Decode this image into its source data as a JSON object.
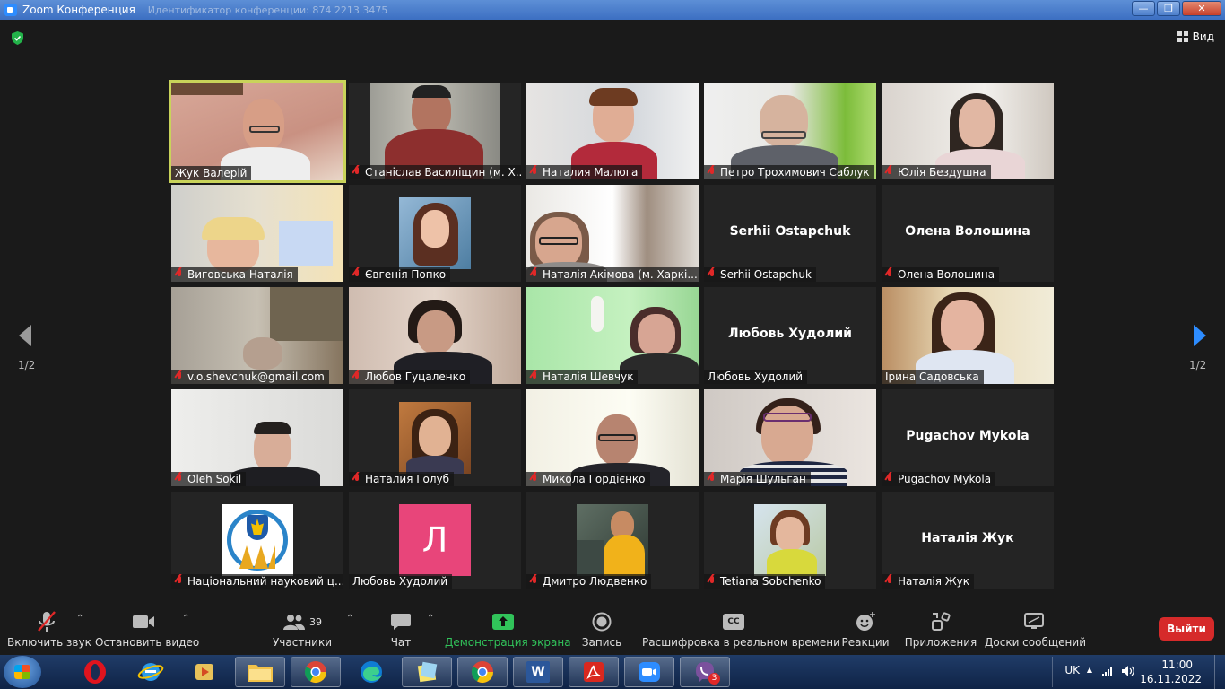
{
  "window": {
    "title": "Zoom Конференция",
    "faded_title": "Идентификатор конференции: 874 2213 3475",
    "minimize": "—",
    "maximize": "❐",
    "close": "✕"
  },
  "topbar": {
    "view_label": "Вид"
  },
  "gallery": {
    "page_left": "1/2",
    "page_right": "1/2",
    "tiles": [
      {
        "name": "Жук Валерій",
        "muted": false,
        "active": true
      },
      {
        "name": "Станіслав Василіщин (м. Х...",
        "muted": true
      },
      {
        "name": "Наталия Малюга",
        "muted": true
      },
      {
        "name": "Петро Трохимович Саблук",
        "muted": true
      },
      {
        "name": "Юлія Бездушна",
        "muted": true
      },
      {
        "name": "Виговська Наталія",
        "muted": true
      },
      {
        "name": "Євгенія Попко",
        "muted": true
      },
      {
        "name": "Наталія Акімова (м. Харкі...",
        "muted": true
      },
      {
        "name": "Serhii Ostapchuk",
        "muted": true,
        "big": "Serhii Ostapchuk"
      },
      {
        "name": "Олена Волошина",
        "muted": true,
        "big": "Олена Волошина"
      },
      {
        "name": "v.o.shevchuk@gmail.com",
        "muted": true
      },
      {
        "name": "Любов Гуцаленко",
        "muted": true
      },
      {
        "name": "Наталія Шевчук",
        "muted": true
      },
      {
        "name": "Любовь Худолий",
        "muted": false,
        "big": "Любовь Худолий"
      },
      {
        "name": "Ірина Садовська",
        "muted": false
      },
      {
        "name": "Oleh Sokil",
        "muted": true
      },
      {
        "name": "Наталия Голуб",
        "muted": true
      },
      {
        "name": "Микола Гордієнко",
        "muted": true
      },
      {
        "name": "Марія Шульган",
        "muted": true
      },
      {
        "name": "Pugachov Mykola",
        "muted": true,
        "big": "Pugachov Mykola"
      },
      {
        "name": "Національний науковий ц...",
        "muted": true
      },
      {
        "name": "Любовь Худолий",
        "muted": false,
        "letter": "Л"
      },
      {
        "name": "Дмитро Людвенко",
        "muted": true
      },
      {
        "name": "Tetiana Sobchenko",
        "muted": true
      },
      {
        "name": "Наталія Жук",
        "muted": true,
        "big": "Наталія Жук"
      }
    ]
  },
  "toolbar": {
    "audio": "Включить звук",
    "video": "Остановить видео",
    "participants": "Участники",
    "participants_count": "39",
    "chat": "Чат",
    "share": "Демонстрация экрана",
    "record": "Запись",
    "captions": "Расшифровка в реальном времени",
    "captions_badge": "CC",
    "reactions": "Реакции",
    "apps": "Приложения",
    "whiteboards": "Доски сообщений",
    "leave": "Выйти"
  },
  "taskbar": {
    "word_label": "W",
    "viber_badge": "3",
    "lang": "UK",
    "time": "11:00",
    "date": "16.11.2022"
  },
  "colors": {
    "active_speaker": "#c9d35a",
    "share_green": "#31c35a",
    "leave_red": "#d62a2a",
    "muted_red": "#e02828",
    "letter_avatar": "#e8457a"
  }
}
